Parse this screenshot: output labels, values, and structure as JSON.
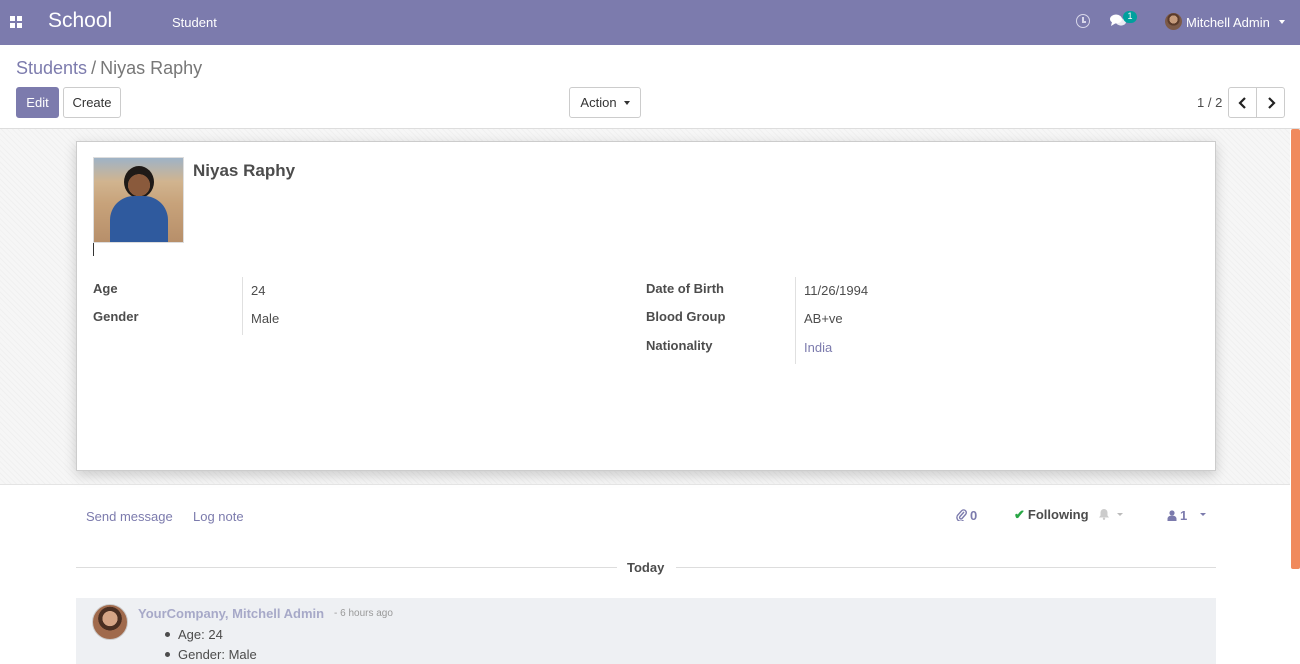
{
  "nav": {
    "brand": "School",
    "menu_student": "Student",
    "chat_badge": "1",
    "user_name": "Mitchell Admin"
  },
  "breadcrumb": {
    "parent": "Students",
    "separator": "/",
    "current": "Niyas Raphy"
  },
  "toolbar": {
    "edit_label": "Edit",
    "create_label": "Create",
    "action_label": "Action"
  },
  "pager": {
    "label": "1 / 2"
  },
  "student": {
    "name": "Niyas Raphy",
    "fields_left": [
      {
        "label": "Age",
        "value": "24"
      },
      {
        "label": "Gender",
        "value": "Male"
      }
    ],
    "fields_right": [
      {
        "label": "Date of Birth",
        "value": "11/26/1994"
      },
      {
        "label": "Blood Group",
        "value": "AB+ve"
      },
      {
        "label": "Nationality",
        "value": "India"
      }
    ]
  },
  "chatter": {
    "send_message": "Send message",
    "log_note": "Log note",
    "attachments": "0",
    "following": "Following",
    "followers": "1",
    "today": "Today",
    "message": {
      "author": "YourCompany, Mitchell Admin",
      "time": "- 6 hours ago",
      "items": [
        "Age: 24",
        "Gender: Male"
      ]
    }
  },
  "colors": {
    "brand": "#7c7bad",
    "accent_scroll": "#f08a5d",
    "following_check": "#28a745"
  }
}
